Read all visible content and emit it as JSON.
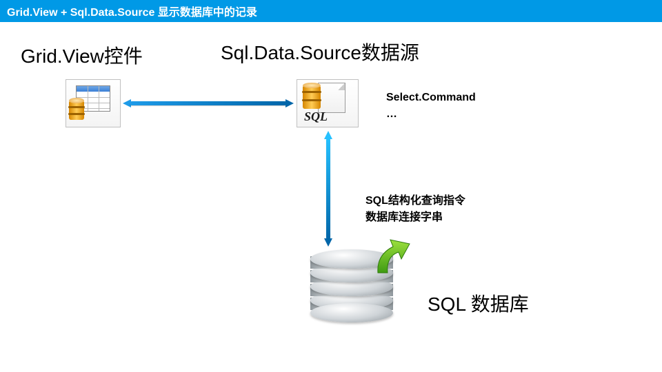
{
  "header": {
    "title": "Grid.View + Sql.Data.Source 显示数据库中的记录"
  },
  "left": {
    "heading": "Grid.View控件"
  },
  "right": {
    "heading": "Sql.Data.Source数据源"
  },
  "sql_icon": {
    "label": "SQL"
  },
  "annotations": {
    "select_command_line1": "Select.Command",
    "select_command_line2": "…",
    "middle_line1": "SQL结构化查询指令",
    "middle_line2": "数据库连接字串",
    "db_label": "SQL 数据库"
  }
}
